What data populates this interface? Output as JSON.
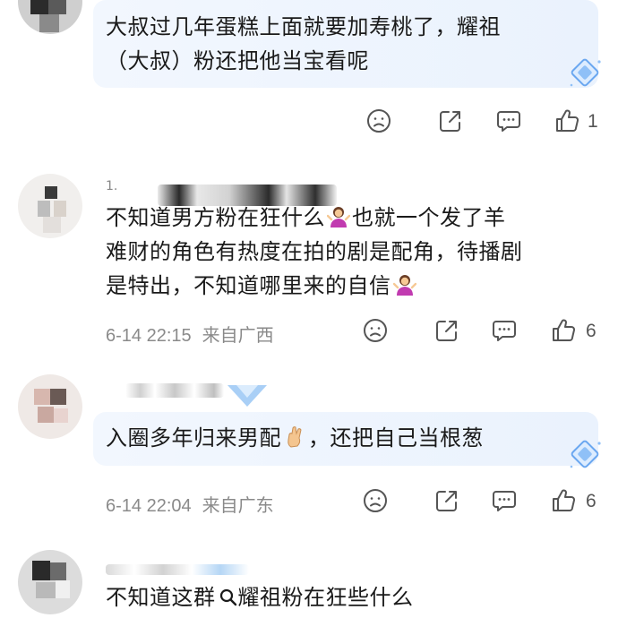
{
  "comments": [
    {
      "text": "大叔过几年蛋糕上面就要加寿桃了，耀祖（大叔）粉还把他当宝看呢",
      "line1": "大叔过几年蛋糕上面就要加寿桃了，耀祖",
      "line2": "（大叔）粉还把他当宝看呢",
      "like_count": "1"
    },
    {
      "name_prefix": "1.",
      "line1": "不知道男方粉在狂什么",
      "line1b": "也就一个发了羊",
      "line2": "难财的角色有热度在拍的剧是配角，待播剧",
      "line3": "是特出，不知道哪里来的自信",
      "time": "6-14 22:15",
      "location": "来自广西",
      "like_count": "6"
    },
    {
      "line1a": "入圈多年归来男配",
      "line1b": "，还把自己当根葱",
      "time": "6-14 22:04",
      "location": "来自广东",
      "like_count": "6"
    },
    {
      "line1a": "不知道这群",
      "search_tag": "耀祖粉",
      "line1b": "在狂些什么"
    }
  ],
  "icons": {
    "dislike": "sad-face-icon",
    "share": "share-icon",
    "comment": "comment-icon",
    "like": "thumbs-up-icon",
    "emoji_shrug": "person-shrugging-emoji",
    "emoji_finger": "crossed-fingers-emoji",
    "badge": "diamond-badge-icon",
    "search": "search-icon"
  },
  "colors": {
    "bubble": "#eef5fd",
    "meta_text": "#8a8a8a",
    "icon_stroke": "#555555",
    "badge_blue": "#6aa7f0"
  }
}
